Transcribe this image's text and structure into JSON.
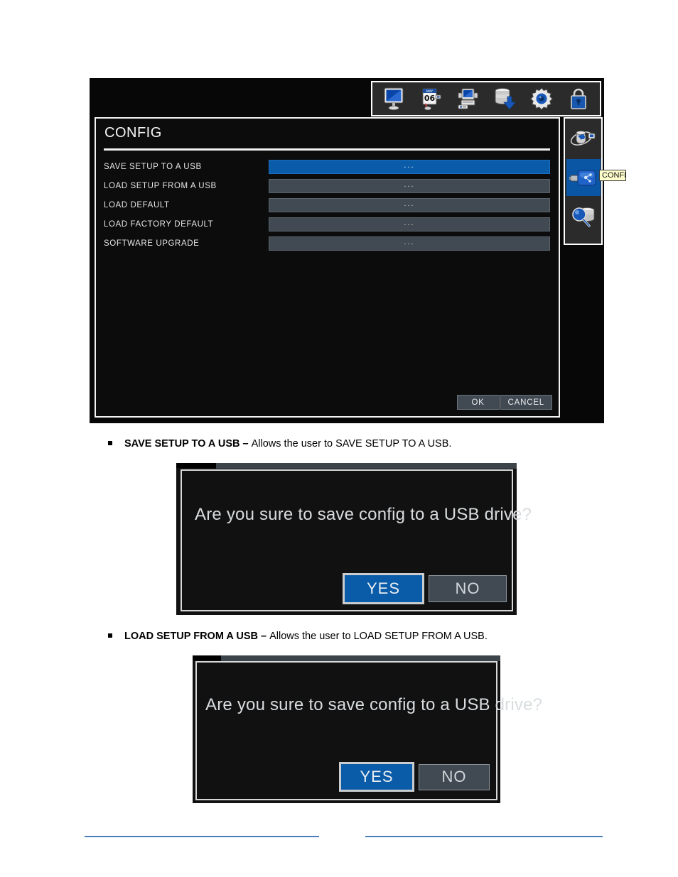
{
  "page": {
    "background": "#ffffff"
  },
  "dvr": {
    "panel_title": "CONFIG",
    "toolbar": {
      "icons": [
        {
          "name": "display-monitor-icon",
          "label": "DISPLAY"
        },
        {
          "name": "schedule-calendar-icon",
          "label": "SCHEDULE"
        },
        {
          "name": "camera-device-icon",
          "label": "CAMERA"
        },
        {
          "name": "backup-database-icon",
          "label": "BACKUP"
        },
        {
          "name": "settings-gear-icon",
          "label": "SYSTEM"
        },
        {
          "name": "security-lock-icon",
          "label": "SECURITY"
        }
      ]
    },
    "sidebar": {
      "icons": [
        {
          "name": "network-system-icon",
          "label": "NETWORK",
          "active": false
        },
        {
          "name": "usb-drive-icon",
          "label": "CONFIG",
          "active": true
        },
        {
          "name": "search-database-icon",
          "label": "INFORMATION",
          "active": false
        }
      ],
      "tooltip": "CONFIG"
    },
    "rows": [
      {
        "label": "SAVE SETUP TO A USB",
        "value": "...",
        "selected": true
      },
      {
        "label": "LOAD SETUP FROM A USB",
        "value": "...",
        "selected": false
      },
      {
        "label": "LOAD DEFAULT",
        "value": "...",
        "selected": false
      },
      {
        "label": "LOAD FACTORY DEFAULT",
        "value": "...",
        "selected": false
      },
      {
        "label": "SOFTWARE UPGRADE",
        "value": "...",
        "selected": false
      }
    ],
    "buttons": {
      "ok": "OK",
      "cancel": "CANCEL"
    },
    "colors": {
      "selected_row": "#0a5ba8",
      "row": "#414a52",
      "panel_background": "#0c0c0c"
    }
  },
  "body": {
    "bullets": [
      {
        "term": "SAVE SETUP TO A USB – ",
        "description": "Allows the user to SAVE SETUP TO A USB."
      },
      {
        "term": "LOAD SETUP FROM A USB – ",
        "description": "Allows the user to LOAD SETUP FROM A USB."
      }
    ]
  },
  "dialogs": [
    {
      "message": "Are you sure to save config to a USB drive?",
      "yes_label": "YES",
      "no_label": "NO"
    },
    {
      "message": "Are you sure to save config to a USB drive?",
      "yes_label": "YES",
      "no_label": "NO"
    }
  ],
  "footer": {
    "rule_color": "#4a7ebb"
  }
}
